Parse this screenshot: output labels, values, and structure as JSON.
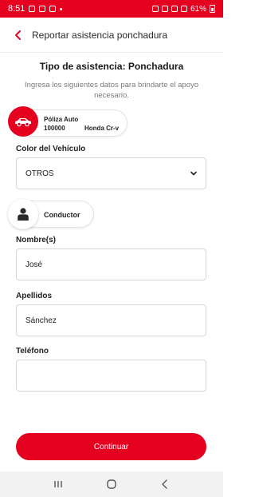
{
  "status_bar": {
    "time": "8:51",
    "battery": "61%"
  },
  "header": {
    "title": "Reportar asistencia ponchadura"
  },
  "section": {
    "title": "Tipo de asistencia: Ponchadura",
    "intro": "Ingresa los siguientes datos para brindarte el apoyo necesario."
  },
  "policy": {
    "label": "Póliza Auto",
    "number": "100000",
    "vehicle": "Honda Cr-v",
    "icon": "car-icon"
  },
  "vehicle_color": {
    "label": "Color del Vehículo",
    "selected": "OTROS"
  },
  "driver": {
    "label": "Conductor",
    "icon": "person-icon"
  },
  "form": {
    "first_name_label": "Nombre(s)",
    "first_name_value": "José",
    "last_name_label": "Apellidos",
    "last_name_value": "Sánchez",
    "phone_label": "Teléfono",
    "phone_value": ""
  },
  "cta": {
    "label": "Continuar"
  },
  "colors": {
    "brand": "#e60020",
    "text": "#1f1f1f",
    "muted": "#7a7a7a",
    "border": "#d6d6d6"
  }
}
